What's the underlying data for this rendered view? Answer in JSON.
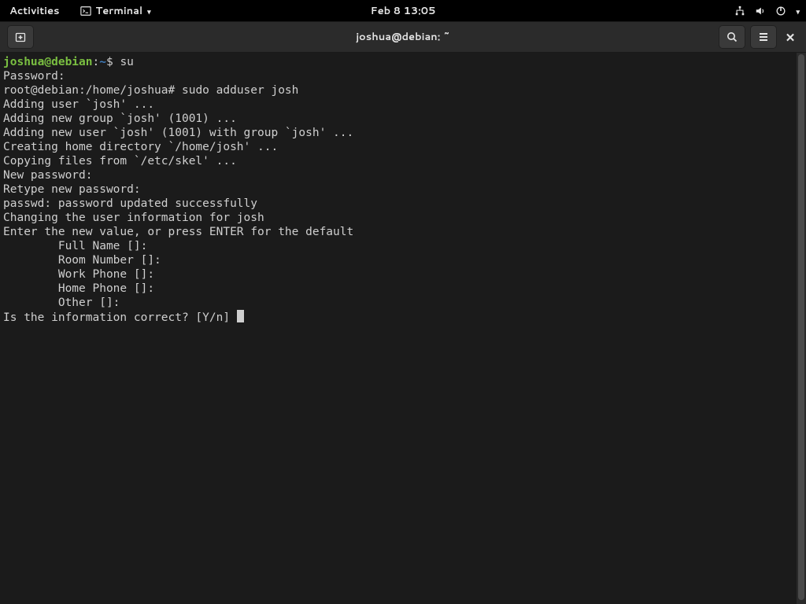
{
  "topbar": {
    "activities": "Activities",
    "terminal_label": "Terminal",
    "clock": "Feb 8  13:05"
  },
  "window": {
    "title": "joshua@debian: ~"
  },
  "prompt1": {
    "user_host": "joshua@debian",
    "sep": ":",
    "path": "~",
    "sigil": "$ ",
    "cmd": "su"
  },
  "lines": {
    "l2": "Password: ",
    "l3_prompt": "root@debian:/home/joshua# ",
    "l3_cmd": "sudo adduser josh",
    "l4": "Adding user `josh' ...",
    "l5": "Adding new group `josh' (1001) ...",
    "l6": "Adding new user `josh' (1001) with group `josh' ...",
    "l7": "Creating home directory `/home/josh' ...",
    "l8": "Copying files from `/etc/skel' ...",
    "l9": "New password: ",
    "l10": "Retype new password: ",
    "l11": "passwd: password updated successfully",
    "l12": "Changing the user information for josh",
    "l13": "Enter the new value, or press ENTER for the default",
    "l14": "        Full Name []: ",
    "l15": "        Room Number []: ",
    "l16": "        Work Phone []: ",
    "l17": "        Home Phone []: ",
    "l18": "        Other []: ",
    "l19": "Is the information correct? [Y/n] "
  }
}
